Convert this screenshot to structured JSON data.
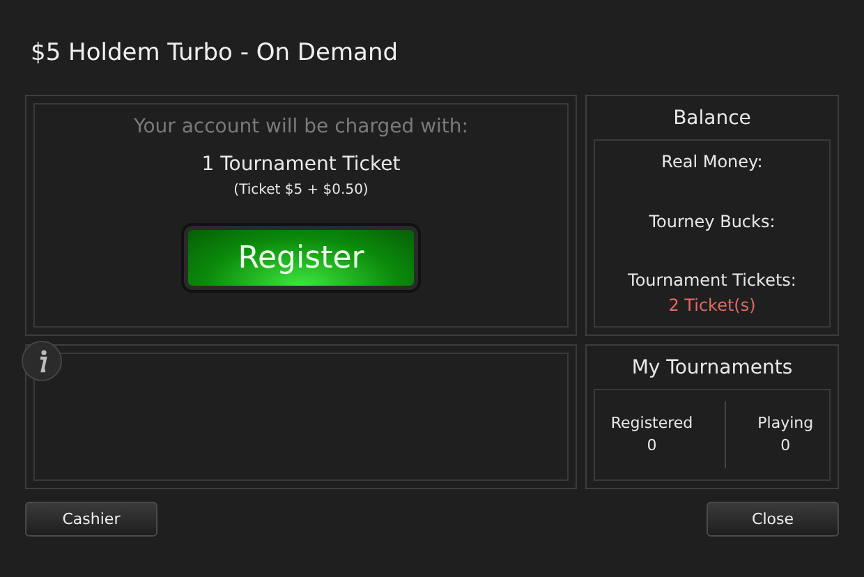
{
  "window": {
    "title": "$5 Holdem Turbo - On Demand"
  },
  "charge": {
    "intro": "Your account will be charged with:",
    "item": "1 Tournament Ticket",
    "detail": "(Ticket $5 + $0.50)"
  },
  "register_button": "Register",
  "balance": {
    "title": "Balance",
    "items": [
      {
        "label": "Real Money:"
      },
      {
        "label": "Tourney Bucks:"
      },
      {
        "label": "Tournament Tickets:",
        "value": "2 Ticket(s)"
      }
    ]
  },
  "my_tournaments": {
    "title": "My Tournaments",
    "stats": [
      {
        "label": "Registered",
        "value": "0"
      },
      {
        "label": "Playing",
        "value": "0"
      }
    ]
  },
  "buttons": {
    "left": "Cashier",
    "right": "Close"
  }
}
